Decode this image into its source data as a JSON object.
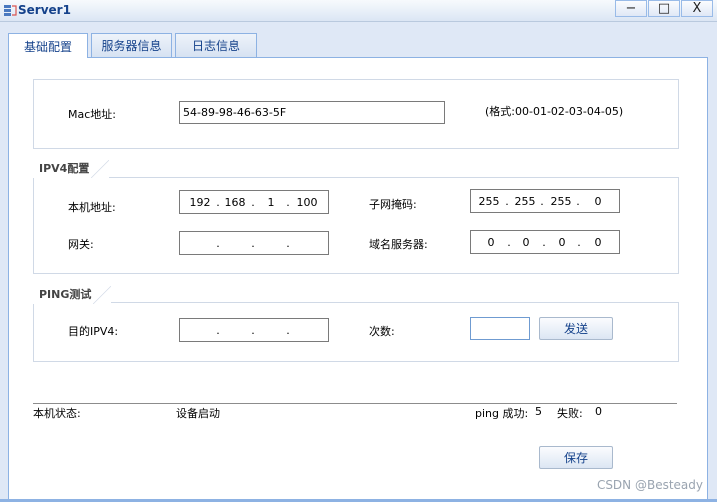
{
  "window": {
    "title": "Server1",
    "minimize": "−",
    "maximize": "□",
    "close": "X"
  },
  "tabs": [
    {
      "label": "基础配置"
    },
    {
      "label": "服务器信息"
    },
    {
      "label": "日志信息"
    }
  ],
  "mac": {
    "label": "Mac地址:",
    "value": "54-89-98-46-63-5F",
    "format_hint": "(格式:00-01-02-03-04-05)"
  },
  "ipv4": {
    "legend": "IPV4配置",
    "host_ip_label": "本机地址:",
    "host_ip": [
      "192",
      "168",
      "1",
      "100"
    ],
    "mask_label": "子网掩码:",
    "mask": [
      "255",
      "255",
      "255",
      "0"
    ],
    "gateway_label": "网关:",
    "gateway": [
      "",
      "",
      "",
      ""
    ],
    "dns_label": "域名服务器:",
    "dns": [
      "0",
      "0",
      "0",
      "0"
    ]
  },
  "ping": {
    "legend": "PING测试",
    "dest_label": "目的IPV4:",
    "dest": [
      "",
      "",
      "",
      ""
    ],
    "count_label": "次数:",
    "count_value": "",
    "send_button": "发送"
  },
  "status": {
    "label": "本机状态:",
    "value": "设备启动",
    "ping_success_label": "ping 成功:",
    "ping_success": "5",
    "fail_label": "失败:",
    "fail": "0"
  },
  "save_button": "保存",
  "watermark": "CSDN @Besteady",
  "colors": {
    "title": "#15428b",
    "tab_border": "#8db2e3",
    "background": "#dfe8f6"
  }
}
